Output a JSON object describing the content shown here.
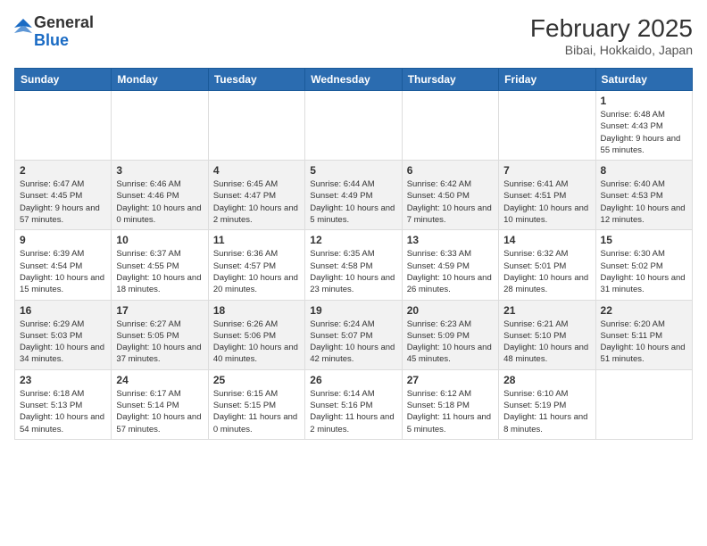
{
  "header": {
    "logo_general": "General",
    "logo_blue": "Blue",
    "month_year": "February 2025",
    "location": "Bibai, Hokkaido, Japan"
  },
  "weekdays": [
    "Sunday",
    "Monday",
    "Tuesday",
    "Wednesday",
    "Thursday",
    "Friday",
    "Saturday"
  ],
  "weeks": [
    [
      {
        "day": "",
        "info": ""
      },
      {
        "day": "",
        "info": ""
      },
      {
        "day": "",
        "info": ""
      },
      {
        "day": "",
        "info": ""
      },
      {
        "day": "",
        "info": ""
      },
      {
        "day": "",
        "info": ""
      },
      {
        "day": "1",
        "info": "Sunrise: 6:48 AM\nSunset: 4:43 PM\nDaylight: 9 hours and 55 minutes."
      }
    ],
    [
      {
        "day": "2",
        "info": "Sunrise: 6:47 AM\nSunset: 4:45 PM\nDaylight: 9 hours and 57 minutes."
      },
      {
        "day": "3",
        "info": "Sunrise: 6:46 AM\nSunset: 4:46 PM\nDaylight: 10 hours and 0 minutes."
      },
      {
        "day": "4",
        "info": "Sunrise: 6:45 AM\nSunset: 4:47 PM\nDaylight: 10 hours and 2 minutes."
      },
      {
        "day": "5",
        "info": "Sunrise: 6:44 AM\nSunset: 4:49 PM\nDaylight: 10 hours and 5 minutes."
      },
      {
        "day": "6",
        "info": "Sunrise: 6:42 AM\nSunset: 4:50 PM\nDaylight: 10 hours and 7 minutes."
      },
      {
        "day": "7",
        "info": "Sunrise: 6:41 AM\nSunset: 4:51 PM\nDaylight: 10 hours and 10 minutes."
      },
      {
        "day": "8",
        "info": "Sunrise: 6:40 AM\nSunset: 4:53 PM\nDaylight: 10 hours and 12 minutes."
      }
    ],
    [
      {
        "day": "9",
        "info": "Sunrise: 6:39 AM\nSunset: 4:54 PM\nDaylight: 10 hours and 15 minutes."
      },
      {
        "day": "10",
        "info": "Sunrise: 6:37 AM\nSunset: 4:55 PM\nDaylight: 10 hours and 18 minutes."
      },
      {
        "day": "11",
        "info": "Sunrise: 6:36 AM\nSunset: 4:57 PM\nDaylight: 10 hours and 20 minutes."
      },
      {
        "day": "12",
        "info": "Sunrise: 6:35 AM\nSunset: 4:58 PM\nDaylight: 10 hours and 23 minutes."
      },
      {
        "day": "13",
        "info": "Sunrise: 6:33 AM\nSunset: 4:59 PM\nDaylight: 10 hours and 26 minutes."
      },
      {
        "day": "14",
        "info": "Sunrise: 6:32 AM\nSunset: 5:01 PM\nDaylight: 10 hours and 28 minutes."
      },
      {
        "day": "15",
        "info": "Sunrise: 6:30 AM\nSunset: 5:02 PM\nDaylight: 10 hours and 31 minutes."
      }
    ],
    [
      {
        "day": "16",
        "info": "Sunrise: 6:29 AM\nSunset: 5:03 PM\nDaylight: 10 hours and 34 minutes."
      },
      {
        "day": "17",
        "info": "Sunrise: 6:27 AM\nSunset: 5:05 PM\nDaylight: 10 hours and 37 minutes."
      },
      {
        "day": "18",
        "info": "Sunrise: 6:26 AM\nSunset: 5:06 PM\nDaylight: 10 hours and 40 minutes."
      },
      {
        "day": "19",
        "info": "Sunrise: 6:24 AM\nSunset: 5:07 PM\nDaylight: 10 hours and 42 minutes."
      },
      {
        "day": "20",
        "info": "Sunrise: 6:23 AM\nSunset: 5:09 PM\nDaylight: 10 hours and 45 minutes."
      },
      {
        "day": "21",
        "info": "Sunrise: 6:21 AM\nSunset: 5:10 PM\nDaylight: 10 hours and 48 minutes."
      },
      {
        "day": "22",
        "info": "Sunrise: 6:20 AM\nSunset: 5:11 PM\nDaylight: 10 hours and 51 minutes."
      }
    ],
    [
      {
        "day": "23",
        "info": "Sunrise: 6:18 AM\nSunset: 5:13 PM\nDaylight: 10 hours and 54 minutes."
      },
      {
        "day": "24",
        "info": "Sunrise: 6:17 AM\nSunset: 5:14 PM\nDaylight: 10 hours and 57 minutes."
      },
      {
        "day": "25",
        "info": "Sunrise: 6:15 AM\nSunset: 5:15 PM\nDaylight: 11 hours and 0 minutes."
      },
      {
        "day": "26",
        "info": "Sunrise: 6:14 AM\nSunset: 5:16 PM\nDaylight: 11 hours and 2 minutes."
      },
      {
        "day": "27",
        "info": "Sunrise: 6:12 AM\nSunset: 5:18 PM\nDaylight: 11 hours and 5 minutes."
      },
      {
        "day": "28",
        "info": "Sunrise: 6:10 AM\nSunset: 5:19 PM\nDaylight: 11 hours and 8 minutes."
      },
      {
        "day": "",
        "info": ""
      }
    ]
  ]
}
